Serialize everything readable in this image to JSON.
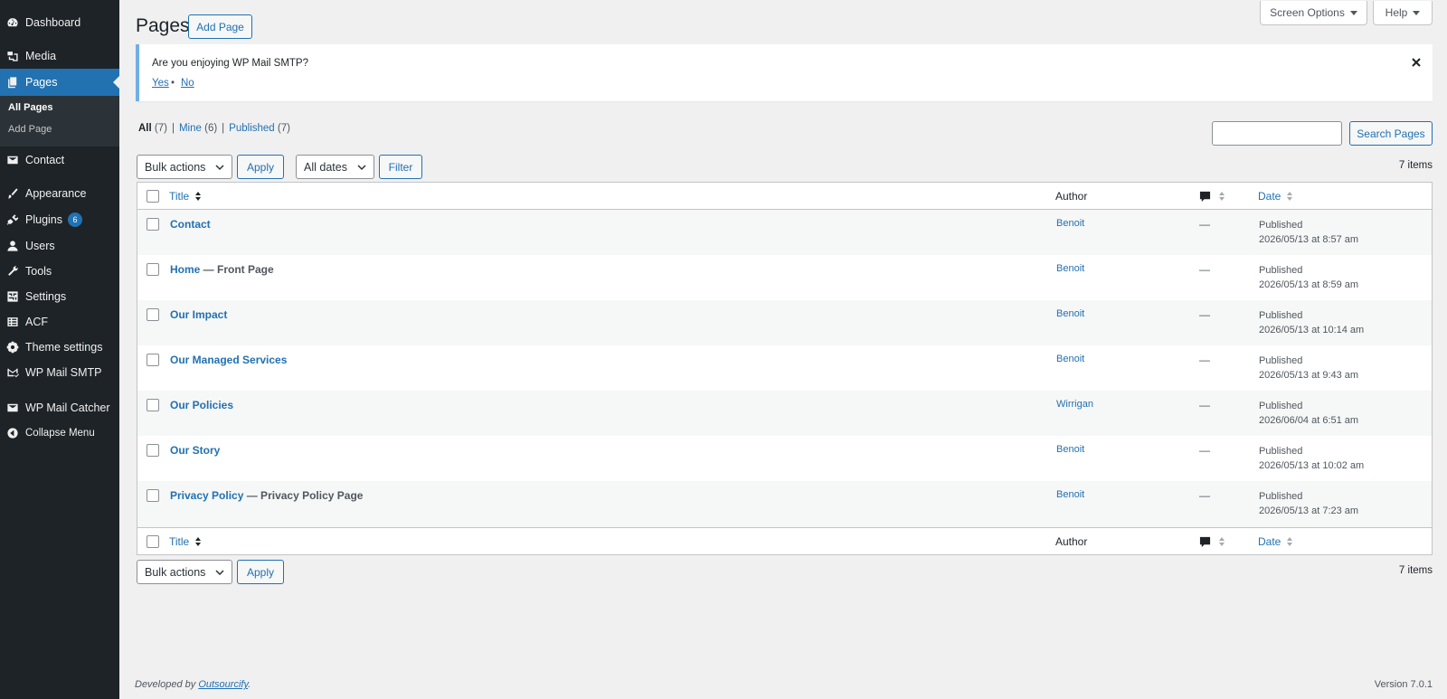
{
  "sidebar": {
    "items": [
      {
        "label": "Dashboard",
        "icon": "dashboard-icon"
      },
      {
        "label": "Media",
        "icon": "media-icon"
      },
      {
        "label": "Pages",
        "icon": "pages-icon"
      },
      {
        "label": "Contact",
        "icon": "mail-icon"
      },
      {
        "label": "Appearance",
        "icon": "brush-icon"
      },
      {
        "label": "Plugins",
        "icon": "plugin-icon",
        "badge": "6"
      },
      {
        "label": "Users",
        "icon": "user-icon"
      },
      {
        "label": "Tools",
        "icon": "wrench-icon"
      },
      {
        "label": "Settings",
        "icon": "settings-icon"
      },
      {
        "label": "ACF",
        "icon": "grid-icon"
      },
      {
        "label": "Theme settings",
        "icon": "gear-icon"
      },
      {
        "label": "WP Mail SMTP",
        "icon": "mail-check-icon"
      },
      {
        "label": "WP Mail Catcher",
        "icon": "mail-icon"
      },
      {
        "label": "Collapse Menu",
        "icon": "collapse-icon"
      }
    ],
    "submenu": [
      {
        "label": "All Pages"
      },
      {
        "label": "Add Page"
      }
    ]
  },
  "header": {
    "screen_options": "Screen Options",
    "help": "Help",
    "title": "Pages",
    "add_new": "Add Page"
  },
  "notice": {
    "text": "Are you enjoying WP Mail SMTP?",
    "yes": "Yes",
    "sep": "•",
    "no": "No"
  },
  "views": [
    {
      "label": "All",
      "count": "(7)"
    },
    {
      "label": "Mine",
      "count": "(6)"
    },
    {
      "label": "Published",
      "count": "(7)"
    }
  ],
  "views_sep": "|",
  "search": {
    "button": "Search Pages",
    "value": ""
  },
  "toolbar_top": {
    "bulk": "Bulk actions",
    "apply": "Apply",
    "dates": "All dates",
    "filter": "Filter",
    "items": "7 items"
  },
  "toolbar_bottom": {
    "bulk": "Bulk actions",
    "apply": "Apply",
    "items": "7 items"
  },
  "table": {
    "columns": {
      "title": "Title",
      "author": "Author",
      "date": "Date"
    },
    "rows": [
      {
        "title": "Contact",
        "state": "",
        "author": "Benoit",
        "comments": "—",
        "status": "Published",
        "date": "2026/05/13 at 8:57 am"
      },
      {
        "title": "Home",
        "state": " — Front Page",
        "author": "Benoit",
        "comments": "—",
        "status": "Published",
        "date": "2026/05/13 at 8:59 am"
      },
      {
        "title": "Our Impact",
        "state": "",
        "author": "Benoit",
        "comments": "—",
        "status": "Published",
        "date": "2026/05/13 at 10:14 am"
      },
      {
        "title": "Our Managed Services",
        "state": "",
        "author": "Benoit",
        "comments": "—",
        "status": "Published",
        "date": "2026/05/13 at 9:43 am"
      },
      {
        "title": "Our Policies",
        "state": "",
        "author": "Wirrigan",
        "comments": "—",
        "status": "Published",
        "date": "2026/06/04 at 6:51 am"
      },
      {
        "title": "Our Story",
        "state": "",
        "author": "Benoit",
        "comments": "—",
        "status": "Published",
        "date": "2026/05/13 at 10:02 am"
      },
      {
        "title": "Privacy Policy",
        "state": " — Privacy Policy Page",
        "author": "Benoit",
        "comments": "—",
        "status": "Published",
        "date": "2026/05/13 at 7:23 am"
      }
    ]
  },
  "footer": {
    "prefix": "Developed by ",
    "link": "Outsourcify",
    "suffix": ".",
    "version": "Version 7.0.1"
  },
  "colors": {
    "accent": "#2271b1",
    "sidebar": "#1d2327",
    "notice_border": "#72aee6"
  }
}
